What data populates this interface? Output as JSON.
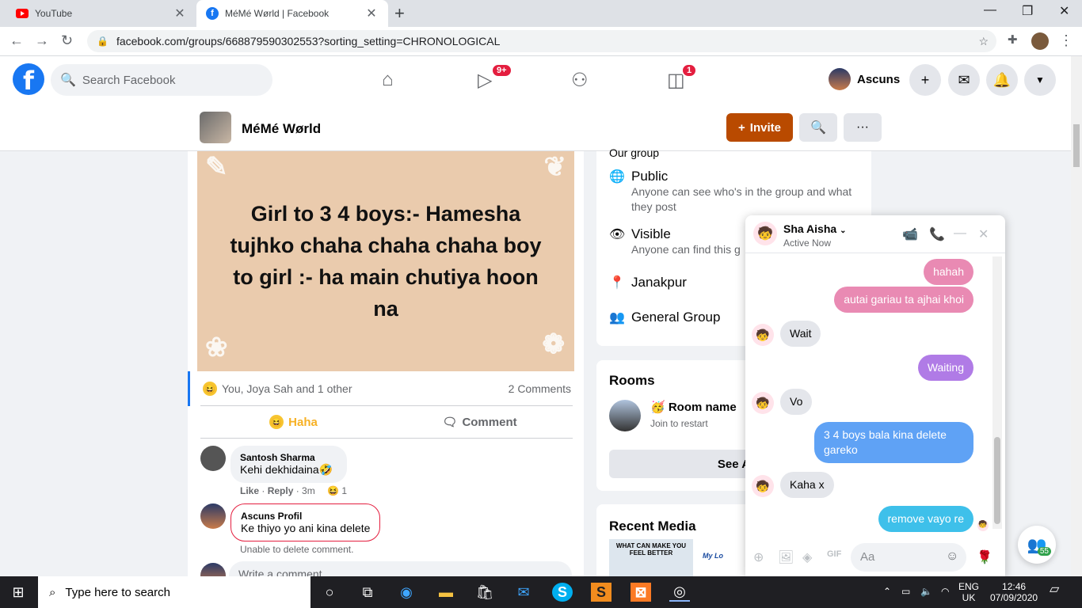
{
  "browser": {
    "tabs": [
      {
        "title": "YouTube",
        "icon": "youtube-icon",
        "color": "#ff0000"
      },
      {
        "title": "MéMé Wørld | Facebook",
        "icon": "facebook-icon",
        "color": "#1877f2"
      }
    ],
    "url": "facebook.com/groups/668879590302553?sorting_setting=CHRONOLOGICAL"
  },
  "fb": {
    "search_placeholder": "Search Facebook",
    "watch_badge": "9+",
    "gaming_badge": "1",
    "profile_name": "Ascuns",
    "accent": "#1877f2"
  },
  "group": {
    "name": "MéMé Wørld",
    "invite_label": "Invite"
  },
  "post": {
    "meme_text": "Girl to 3 4 boys:- Hamesha tujhko chaha chaha chaha boy to girl :- ha main chutiya hoon na",
    "reactions": "You, Joya Sah and 1 other",
    "comments_count": "2 Comments",
    "haha_label": "Haha",
    "comment_label": "Comment",
    "comments": [
      {
        "name": "Santosh Sharma",
        "text": "Kehi dekhidaina🤣",
        "like": "Like",
        "reply": "Reply",
        "time": "3m",
        "react_count": "1"
      },
      {
        "name": "Ascuns Profil",
        "text": "Ke thiyo yo ani kina delete",
        "error": "Unable to delete comment."
      }
    ],
    "write_placeholder": "Write a comment..."
  },
  "about": {
    "clip_text": "Our group",
    "rows": [
      {
        "icon": "globe-icon",
        "title": "Public",
        "desc": "Anyone can see who's in the group and what they post"
      },
      {
        "icon": "eye-icon",
        "title": "Visible",
        "desc": "Anyone can find this g"
      },
      {
        "icon": "location-icon",
        "title": "Janakpur",
        "desc": ""
      },
      {
        "icon": "people-icon",
        "title": "General Group",
        "desc": ""
      }
    ]
  },
  "rooms": {
    "title": "Rooms",
    "room_name": "🥳 Room name",
    "room_sub": "Join to restart",
    "see_all": "See A"
  },
  "media": {
    "title": "Recent Media",
    "thumb1": "WHAT CAN MAKE YOU FEEL BETTER",
    "thumb2": "My Lo"
  },
  "chat": {
    "name": "Sha Aisha",
    "status": "Active Now",
    "messages": [
      {
        "dir": "out",
        "text": "hahah"
      },
      {
        "dir": "out",
        "text": "autai gariau ta ajhai khoi"
      },
      {
        "dir": "in",
        "text": "Wait"
      },
      {
        "dir": "out",
        "text": "Waiting"
      },
      {
        "dir": "in",
        "text": "Vo"
      },
      {
        "dir": "out",
        "text": "3 4 boys bala kina delete gareko"
      },
      {
        "dir": "in",
        "text": "Kaha x"
      },
      {
        "dir": "out",
        "text": "remove vayo re"
      }
    ],
    "input_placeholder": "Aa",
    "contacts_count": "55"
  },
  "taskbar": {
    "search_placeholder": "Type here to search",
    "lang": "ENG",
    "region": "UK",
    "time": "12:46",
    "date": "07/09/2020"
  }
}
